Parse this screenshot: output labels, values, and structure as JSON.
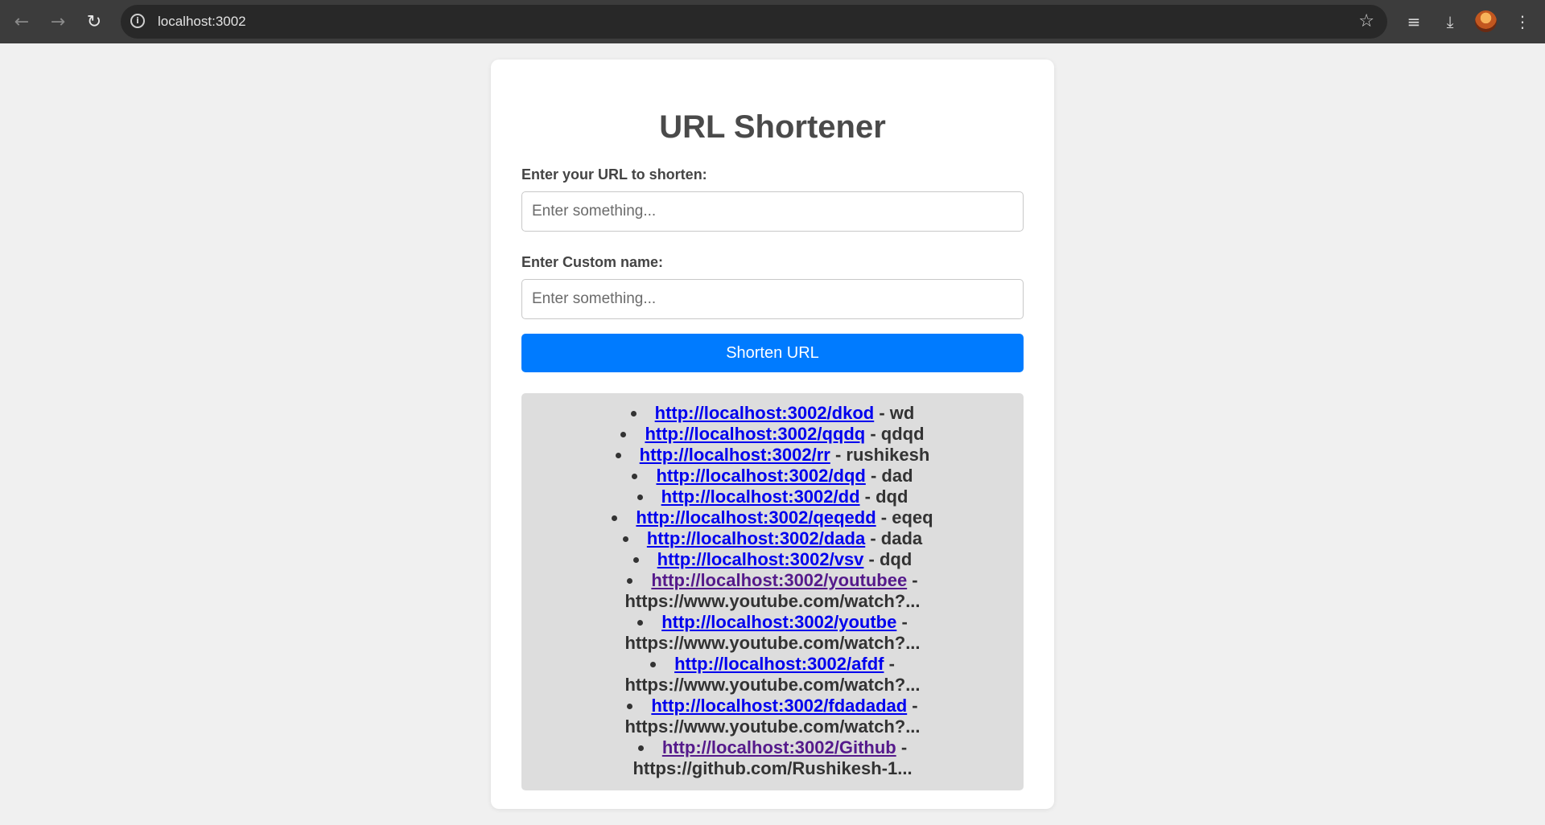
{
  "browser": {
    "url": "localhost:3002",
    "back_icon": "←",
    "forward_icon": "→",
    "reload_icon": "↻",
    "info_icon": "i",
    "star_icon": "☆",
    "queue_icon": "≡",
    "download_icon": "⤓",
    "menu_icon": "⋮"
  },
  "page": {
    "title": "URL Shortener",
    "url_label": "Enter your URL to shorten:",
    "url_placeholder": "Enter something...",
    "name_label": "Enter Custom name:",
    "name_placeholder": "Enter something...",
    "submit_label": "Shorten URL"
  },
  "links": [
    {
      "href": "http://localhost:3002/dkod",
      "separator": " - ",
      "target": "wd",
      "visited": false
    },
    {
      "href": "http://localhost:3002/qqdq",
      "separator": " - ",
      "target": "qdqd",
      "visited": false
    },
    {
      "href": "http://localhost:3002/rr",
      "separator": " - ",
      "target": "rushikesh",
      "visited": false
    },
    {
      "href": "http://localhost:3002/dqd",
      "separator": " - ",
      "target": "dad",
      "visited": false
    },
    {
      "href": "http://localhost:3002/dd",
      "separator": " - ",
      "target": "dqd",
      "visited": false
    },
    {
      "href": "http://localhost:3002/qeqedd",
      "separator": " - ",
      "target": "eqeq",
      "visited": false
    },
    {
      "href": "http://localhost:3002/dada",
      "separator": " - ",
      "target": "dada",
      "visited": false
    },
    {
      "href": "http://localhost:3002/vsv",
      "separator": " - ",
      "target": "dqd",
      "visited": false
    },
    {
      "href": "http://localhost:3002/youtubee",
      "separator": " - ",
      "target": "https://www.youtube.com/watch?...",
      "visited": true
    },
    {
      "href": "http://localhost:3002/youtbe",
      "separator": " - ",
      "target": "https://www.youtube.com/watch?...",
      "visited": false
    },
    {
      "href": "http://localhost:3002/afdf",
      "separator": " - ",
      "target": "https://www.youtube.com/watch?...",
      "visited": false
    },
    {
      "href": "http://localhost:3002/fdadadad",
      "separator": " - ",
      "target": "https://www.youtube.com/watch?...",
      "visited": false
    },
    {
      "href": "http://localhost:3002/Github",
      "separator": " - ",
      "target": "https://github.com/Rushikesh-1...",
      "visited": true
    }
  ],
  "colors": {
    "accent": "#007bff",
    "link": "#0000ee",
    "link_visited": "#551a8b",
    "results_bg": "#dddddd",
    "page_bg": "#f0f0f0"
  }
}
